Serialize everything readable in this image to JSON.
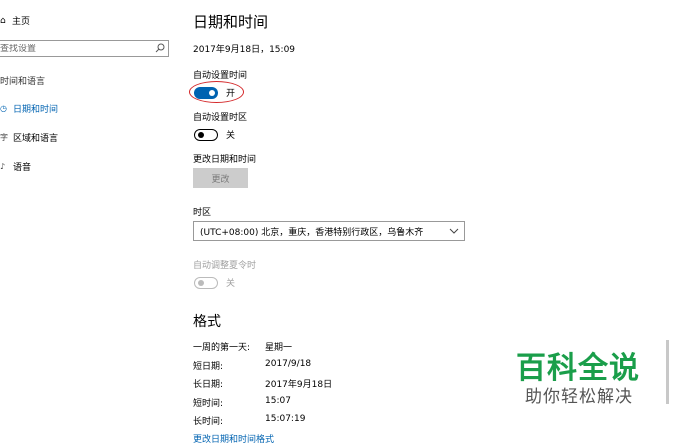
{
  "sidebar": {
    "home_label": "主页",
    "search_placeholder": "查找设置",
    "group_label": "时间和语言",
    "items": [
      {
        "label": "日期和时间",
        "icon": "calendar-clock-icon",
        "active": true
      },
      {
        "label": "区域和语言",
        "icon": "language-icon",
        "active": false
      },
      {
        "label": "语音",
        "icon": "microphone-icon",
        "active": false
      }
    ]
  },
  "main": {
    "title": "日期和时间",
    "current_datetime": "2017年9月18日，15:09",
    "auto_time": {
      "label": "自动设置时间",
      "state": "开",
      "on": true
    },
    "auto_timezone": {
      "label": "自动设置时区",
      "state": "关",
      "on": false
    },
    "change_datetime": {
      "label": "更改日期和时间",
      "button": "更改"
    },
    "timezone": {
      "label": "时区",
      "value": "(UTC+08:00) 北京，重庆，香港特别行政区，乌鲁木齐"
    },
    "dst": {
      "label": "自动调整夏令时",
      "state": "关",
      "disabled": true
    },
    "format": {
      "title": "格式",
      "rows": [
        {
          "key": "一周的第一天:",
          "value": "星期一"
        },
        {
          "key": "短日期:",
          "value": "2017/9/18"
        },
        {
          "key": "长日期:",
          "value": "2017年9月18日"
        },
        {
          "key": "短时间:",
          "value": "15:07"
        },
        {
          "key": "长时间:",
          "value": "15:07:19"
        }
      ],
      "link": "更改日期和时间格式"
    }
  },
  "watermark": {
    "line1": "百科全说",
    "line2": "助你轻松解决"
  },
  "colors": {
    "accent": "#0063b1",
    "highlight_circle": "#d4282a",
    "watermark_green": "#1a9e4a"
  }
}
